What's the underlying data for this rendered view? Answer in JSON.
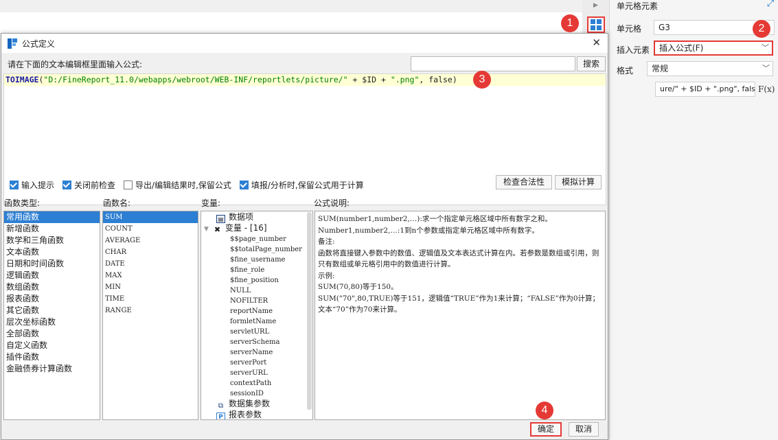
{
  "right_panel": {
    "title": "单元格元素",
    "cell_label": "单元格",
    "cell_value": "G3",
    "insert_label": "插入元素",
    "insert_value": "插入公式(F)",
    "format_label": "格式",
    "format_value": "常规",
    "formula_preview": "ure/\" + $ID + \".png\", false)",
    "fx_label": "F(x)"
  },
  "markers": [
    "1",
    "2",
    "3",
    "4"
  ],
  "dialog": {
    "title": "公式定义",
    "hint": "请在下面的文本编辑框里面输入公式:",
    "search_button": "搜索",
    "search_placeholder": "",
    "formula": {
      "fn": "TOIMAGE",
      "open": "(",
      "str1": "\"D:/FineReport_11.0/webapps/webroot/WEB-INF/reportlets/picture/\"",
      "mid": " + $ID + ",
      "str2": "\".png\"",
      "tail": ", false)"
    },
    "options": [
      {
        "label": "输入提示",
        "checked": true
      },
      {
        "label": "关闭前检查",
        "checked": true
      },
      {
        "label": "导出/编辑结果时,保留公式",
        "checked": false
      },
      {
        "label": "填报/分析时,保留公式用于计算",
        "checked": true
      }
    ],
    "check_button": "检查合法性",
    "simulate_button": "模拟计算",
    "fn_type_label": "函数类型:",
    "fn_types": [
      "常用函数",
      "新增函数",
      "数学和三角函数",
      "文本函数",
      "日期和时间函数",
      "逻辑函数",
      "数组函数",
      "报表函数",
      "其它函数",
      "层次坐标函数",
      "全部函数",
      "自定义函数",
      "插件函数",
      "金融债券计算函数"
    ],
    "fn_name_label": "函数名:",
    "fn_names": [
      "SUM",
      "COUNT",
      "AVERAGE",
      "CHAR",
      "DATE",
      "MAX",
      "MIN",
      "TIME",
      "RANGE"
    ],
    "var_label": "变量:",
    "vars": {
      "data_item": "数据项",
      "var_group": "变量 - [16]",
      "var_items": [
        "$$page_number",
        "$$totalPage_number",
        "$fine_username",
        "$fine_role",
        "$fine_position",
        "NULL",
        "NOFILTER",
        "reportName",
        "formletName",
        "servletURL",
        "serverSchema",
        "serverName",
        "serverPort",
        "serverURL",
        "contextPath",
        "sessionID"
      ],
      "dataset_params": "数据集参数",
      "report_params": "报表参数"
    },
    "desc_label": "公式说明:",
    "desc_lines": [
      "SUM(number1,number2,…):求一个指定单元格区域中所有数字之和。",
      "Number1,number2,…:1到n个参数或指定单元格区域中所有数字。",
      "备注:",
      "函数将直接键入参数中的数值、逻辑值及文本表达式计算在内。若参数是数组或引用，则只有数组或单元格引用中的数值进行计算。",
      "示例:",
      "SUM(70,80)等于150。",
      "SUM(\"70\",80,TRUE)等于151，逻辑值“TRUE”作为1来计算；“FALSE”作为0计算；文本“70”作为70来计算。"
    ],
    "ok_button": "确定",
    "cancel_button": "取消"
  },
  "colors": {
    "accent": "#2d7fd3",
    "marker": "#e53935",
    "formula_bg": "#ffffd4",
    "string": "#008000",
    "function": "#1a1aa6"
  }
}
